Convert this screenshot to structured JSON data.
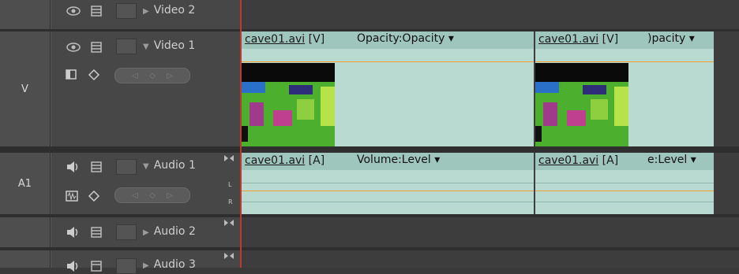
{
  "tracks": {
    "video2": {
      "label": "",
      "name": "Video 2"
    },
    "video1": {
      "label": "V",
      "name": "Video 1"
    },
    "audio1": {
      "label": "A1",
      "name": "Audio 1",
      "left": "L",
      "right": "R"
    },
    "audio2": {
      "label": "",
      "name": "Audio 2"
    },
    "audio3": {
      "label": "",
      "name": "Audio 3"
    }
  },
  "clips": {
    "v1": {
      "file": "cave01.avi",
      "tag": " [V]",
      "effect": "Opacity:Opacity"
    },
    "v2": {
      "file": "cave01.avi",
      "tag": " [V]",
      "effect": ")pacity"
    },
    "a1": {
      "file": "cave01.avi",
      "tag": " [A]",
      "effect": "Volume:Level"
    },
    "a2": {
      "file": "cave01.avi",
      "tag": " [A]",
      "effect": "e:Level"
    }
  },
  "icons": {
    "eye": "eye-icon",
    "sync_lock": "sync-lock-icon",
    "speaker": "speaker-icon",
    "collapse": "expand-triangle-icon",
    "keyframe": "keyframe-diamond-icon",
    "resize": "resize-track-icon"
  },
  "colors": {
    "clip": "#b9dad0",
    "clip_header": "#9fc6bc",
    "playhead": "#c0392b",
    "orange_line": "#f0a030"
  }
}
